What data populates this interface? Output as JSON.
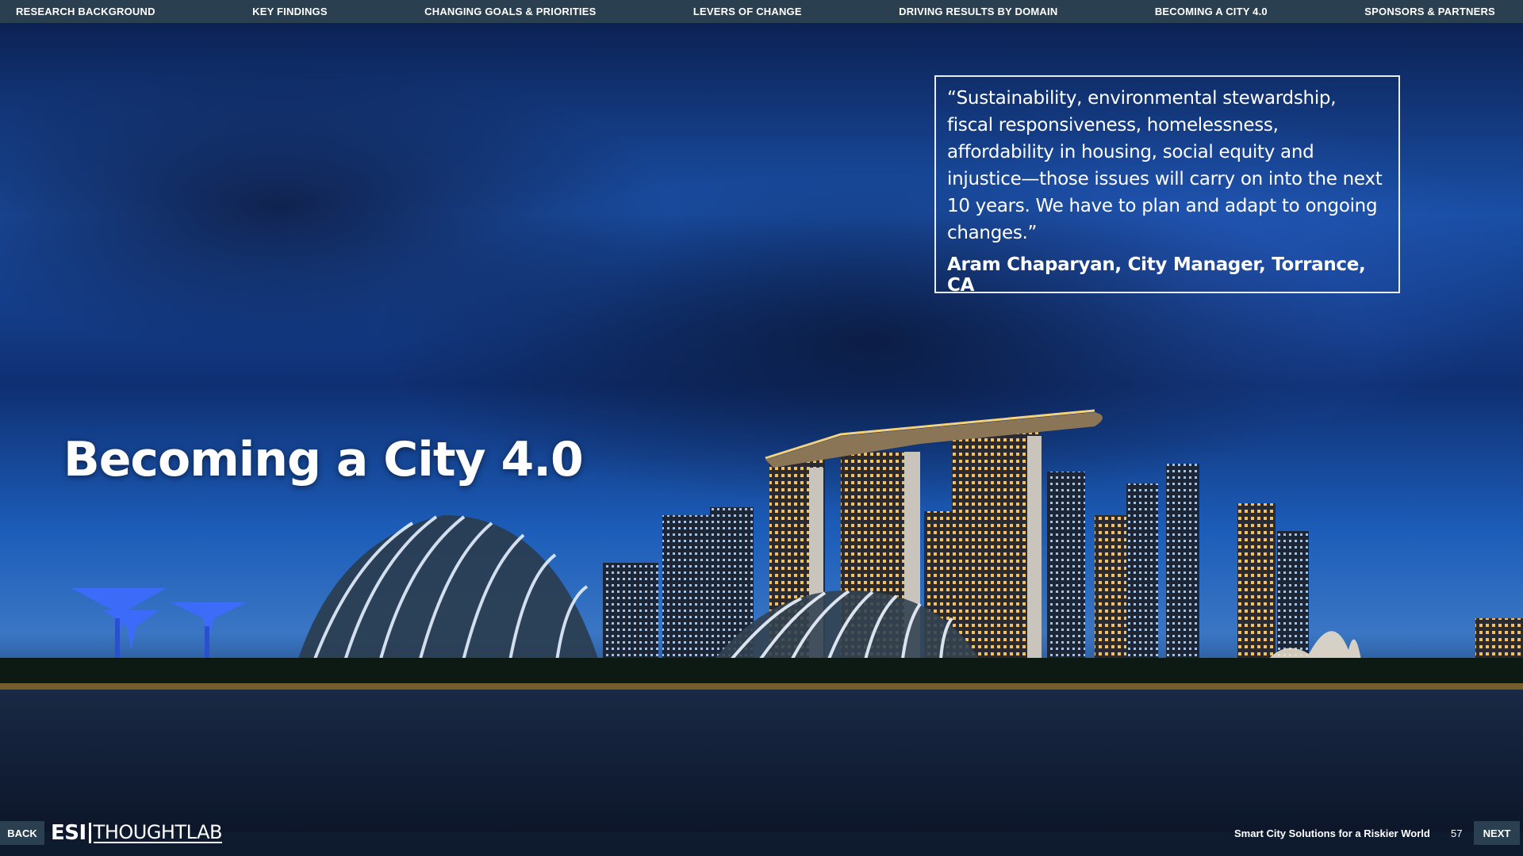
{
  "nav": {
    "items": [
      "RESEARCH BACKGROUND",
      "KEY FINDINGS",
      "CHANGING GOALS & PRIORITIES",
      "LEVERS OF CHANGE",
      "DRIVING RESULTS BY DOMAIN",
      "BECOMING A CITY 4.0",
      "SPONSORS & PARTNERS"
    ]
  },
  "title": "Becoming a City 4.0",
  "quote": {
    "text": "“Sustainability, environmental stewardship, fiscal responsiveness, homelessness, affordability in housing, social equity and injustice—those issues will carry on into the next 10 years. We have to plan and adapt to ongoing changes.”",
    "attribution": "Aram Chaparyan, City Manager, Torrance, CA"
  },
  "footer": {
    "back_label": "BACK",
    "next_label": "NEXT",
    "logo_esi": "ESI",
    "logo_thoughtlab": "THOUGHTLAB",
    "report_title": "Smart City Solutions for a Riskier World",
    "page_number": "57"
  },
  "colors": {
    "nav_bar": "#2a3f4f",
    "text": "#ffffff"
  }
}
